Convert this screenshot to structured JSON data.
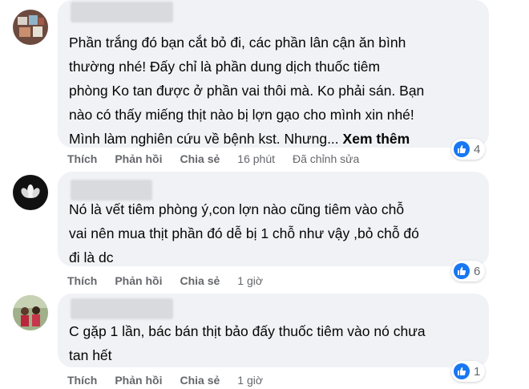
{
  "comments": [
    {
      "lines": [
        "Phần trắng đó bạn cắt bỏ đi, các phần lân cận ăn bình",
        "thường nhé! Đấy chỉ là phần dung dịch thuốc tiêm",
        "phòng Ko tan được ở phần vai thôi mà. Ko phải sán. Bạn",
        "nào có thấy miếng thịt nào bị lợn gạo cho mình xin nhé!",
        "Mình làm nghiên cứu về bệnh kst. Nhưng..."
      ],
      "see_more": "Xem thêm",
      "actions": {
        "like": "Thích",
        "reply": "Phản hồi",
        "share": "Chia sẻ"
      },
      "time": "16 phút",
      "edited": "Đã chỉnh sửa",
      "reaction_count": "4"
    },
    {
      "lines": [
        "Nó là vết tiêm phòng ý,con lợn nào cũng tiêm vào chỗ",
        "vai nên mua thịt phần đó dễ bị 1 chỗ như vậy ,bỏ chỗ đó",
        "đi là dc"
      ],
      "actions": {
        "like": "Thích",
        "reply": "Phản hồi",
        "share": "Chia sẻ"
      },
      "time": "1 giờ",
      "reaction_count": "6"
    },
    {
      "lines": [
        "C gặp 1 lần, bác bán thịt bảo đấy thuốc tiêm vào nó chưa",
        "tan hết"
      ],
      "actions": {
        "like": "Thích",
        "reply": "Phản hồi",
        "share": "Chia sẻ"
      },
      "time": "1 giờ",
      "reaction_count": "1"
    }
  ],
  "colors": {
    "bubble": "#f0f2f5",
    "meta_text": "#65676b",
    "like_blue": "#1877f2"
  },
  "icons": {
    "reaction": "like-thumb-icon"
  }
}
